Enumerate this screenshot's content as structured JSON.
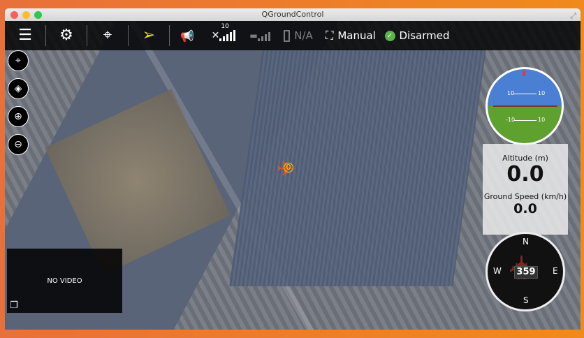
{
  "window": {
    "title": "QGroundControl"
  },
  "toolbar": {
    "menu_icon": "hamburger-icon",
    "settings_icon": "gears-icon",
    "plan_icon": "plan-route-icon",
    "fly_icon": "paper-plane-icon",
    "messages_icon": "megaphone-icon",
    "gps_count": "10",
    "battery": "N/A",
    "flight_mode": "Manual",
    "arm_status": "Disarmed"
  },
  "map_tools": [
    "center-icon",
    "layers-icon",
    "zoom-in-icon",
    "zoom-out-icon"
  ],
  "video": {
    "status": "NO VIDEO"
  },
  "vehicle": {
    "label": "0"
  },
  "instruments": {
    "attitude": {
      "pitch_labels": [
        "10",
        "10",
        "-10",
        "10"
      ]
    },
    "altitude_label": "Altitude (m)",
    "altitude": "0.0",
    "speed_label": "Ground Speed (km/h)",
    "speed": "0.0",
    "compass": {
      "n": "N",
      "s": "S",
      "e": "E",
      "w": "W",
      "heading": "359"
    }
  },
  "colors": {
    "accent": "#e0561e",
    "fly": "#e8e020",
    "ok": "#5ab54a"
  }
}
